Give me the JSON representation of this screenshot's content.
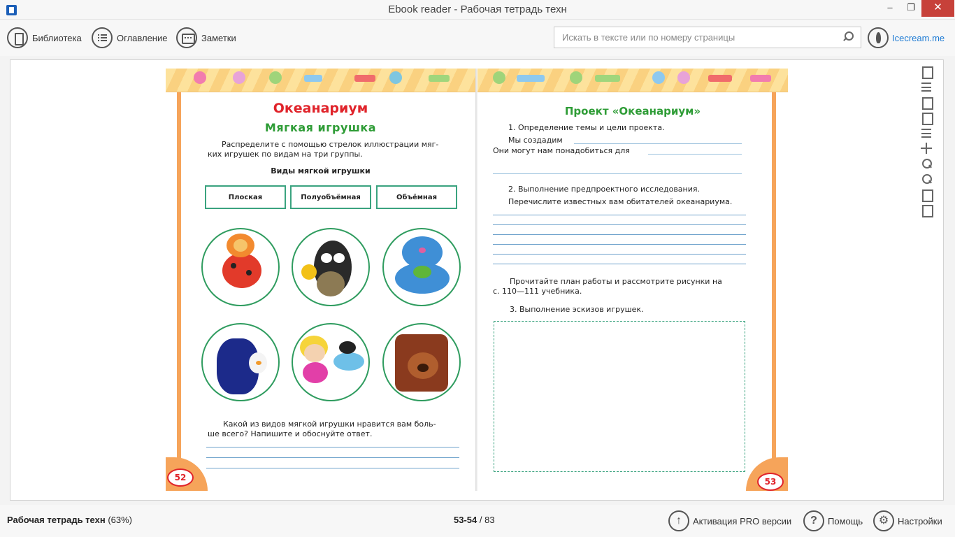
{
  "window": {
    "title": "Ebook reader - Рабочая тетрадь техн",
    "minimize_glyph": "–",
    "maximize_glyph": "❐",
    "close_glyph": "✕"
  },
  "toolbar": {
    "library_label": "Библиотека",
    "contents_label": "Оглавление",
    "notes_label": "Заметки",
    "search_placeholder": "Искать в тексте или по номеру страницы",
    "search_value": "",
    "brand_label": "Icecream.me"
  },
  "left_page": {
    "title": "Океанариум",
    "subtitle": "Мягкая игрушка",
    "instruction_line1": "Распределите с помощью стрелок иллюстрации мяг-",
    "instruction_line2": "ких игрушек по видам на три группы.",
    "types_heading": "Виды мягкой игрушки",
    "types": [
      "Плоская",
      "Полуобъёмная",
      "Объёмная"
    ],
    "question_line1": "Какой из видов мягкой игрушки нравится вам боль-",
    "question_line2": "ше всего? Напишите и обоснуйте ответ.",
    "page_number": "52"
  },
  "right_page": {
    "title": "Проект «Океанариум»",
    "step1": "1. Определение темы и цели проекта.",
    "we_create": "Мы создадим",
    "they_may_need": "Они могут нам понадобиться для",
    "step2": "2. Выполнение предпроектного исследования.",
    "list_inhabitants": "Перечислите известных вам обитателей океанариума.",
    "read_plan_line1": "Прочитайте план работы и рассмотрите рисунки на",
    "read_plan_line2": "с. 110—111 учебника.",
    "step3": "3. Выполнение эскизов игрушек.",
    "page_number": "53"
  },
  "side_tools": [
    "fullscreen-icon",
    "contents-list-icon",
    "bookmark-icon",
    "comment-icon",
    "text-lines-icon",
    "brightness-icon",
    "zoom-in-icon",
    "zoom-out-icon",
    "fit-page-icon",
    "actual-size-icon"
  ],
  "status": {
    "book_title": "Рабочая тетрадь техн",
    "progress_text": "(63%)",
    "progress_fraction": 0.63,
    "current_pages": "53-54",
    "total_pages": "/ 83",
    "pro_label": "Активация PRO версии",
    "help_label": "Помощь",
    "settings_label": "Настройки",
    "help_glyph": "?",
    "pro_glyph": "↑",
    "settings_glyph": "⚙"
  },
  "colors": {
    "accent_blue": "#1e7bd4",
    "heading_red": "#e0232a",
    "heading_green": "#2e9c36",
    "close_red": "#c7413a",
    "banner_yellow": "#fde29c",
    "page_orange": "#f6a45a"
  }
}
